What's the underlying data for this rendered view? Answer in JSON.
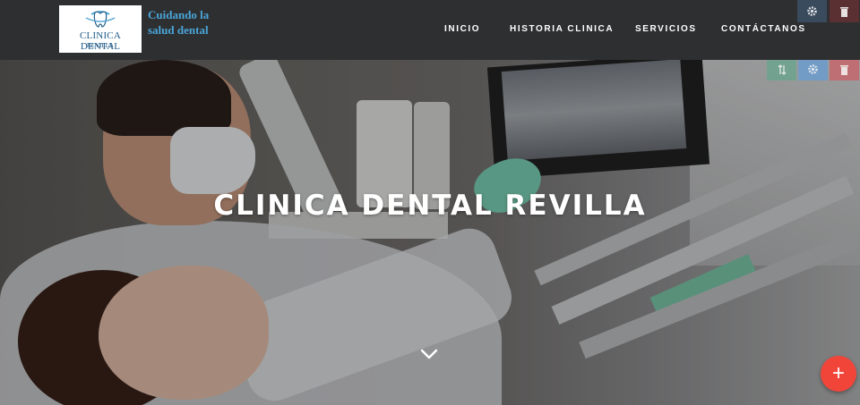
{
  "header": {
    "logo": {
      "name": "CLINICA DENTAL",
      "sub": "REVILLA"
    },
    "tagline": "Cuidando la salud dental",
    "nav": [
      {
        "label": "INICIO"
      },
      {
        "label": "HISTORIA CLINICA"
      },
      {
        "label": "SERVICIOS"
      },
      {
        "label": "CONTÁCTANOS"
      }
    ]
  },
  "hero": {
    "title": "CLINICA DENTAL REVILLA"
  },
  "icons": {
    "edit_settings": "gear-icon",
    "edit_delete": "trash-icon",
    "edit_sort": "sort-arrows-icon",
    "scroll_down": "chevron-down-icon",
    "add": "plus-icon"
  },
  "colors": {
    "header_bg": "#2e2f31",
    "tagline": "#4aa5d8",
    "fab": "#f2453a",
    "logo_blue": "#1e5a88"
  },
  "fab_label": "+"
}
